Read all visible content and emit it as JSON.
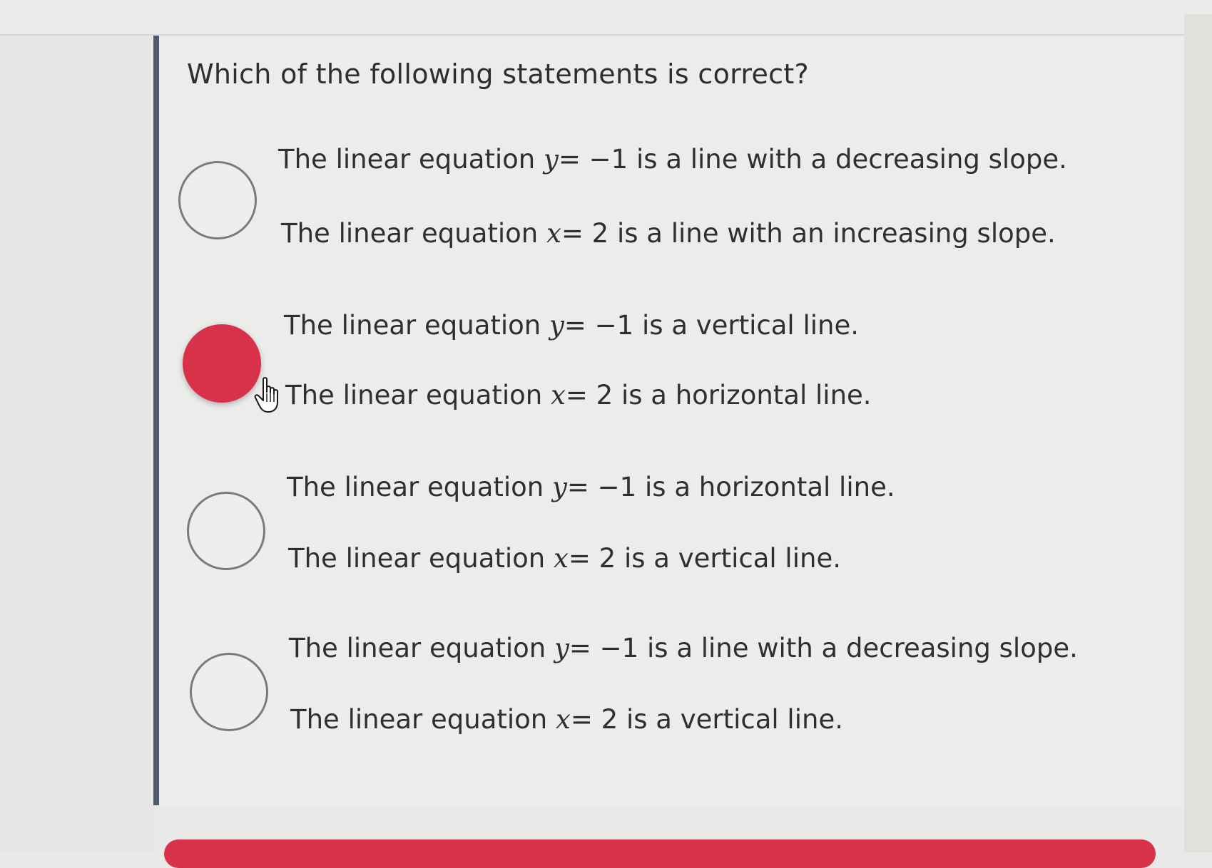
{
  "question": {
    "prompt": "Which of the following statements is correct?"
  },
  "options": [
    {
      "selected": false,
      "lines": [
        {
          "pre": "The linear equation ",
          "var": "y",
          "eq": "= −1",
          "post": " is a line with a decreasing slope."
        },
        {
          "pre": "The linear equation ",
          "var": "x",
          "eq": "= 2",
          "post": " is a line with an increasing slope."
        }
      ]
    },
    {
      "selected": true,
      "lines": [
        {
          "pre": "The linear equation ",
          "var": "y",
          "eq": "= −1",
          "post": " is a vertical line."
        },
        {
          "pre": "The linear equation ",
          "var": "x",
          "eq": "= 2",
          "post": " is a horizontal line."
        }
      ]
    },
    {
      "selected": false,
      "lines": [
        {
          "pre": "The linear equation ",
          "var": "y",
          "eq": "= −1",
          "post": " is a horizontal line."
        },
        {
          "pre": "The linear equation ",
          "var": "x",
          "eq": "= 2",
          "post": " is a vertical line."
        }
      ]
    },
    {
      "selected": false,
      "lines": [
        {
          "pre": "The linear equation ",
          "var": "y",
          "eq": "= −1",
          "post": " is a line with a decreasing slope."
        },
        {
          "pre": "The linear equation ",
          "var": "x",
          "eq": "= 2",
          "post": " is a vertical line."
        }
      ]
    }
  ],
  "colors": {
    "accent": "#d8324a",
    "panel_border": "#4f5a6d"
  },
  "icons": {
    "pointer": "hand-pointer-cursor-icon"
  }
}
